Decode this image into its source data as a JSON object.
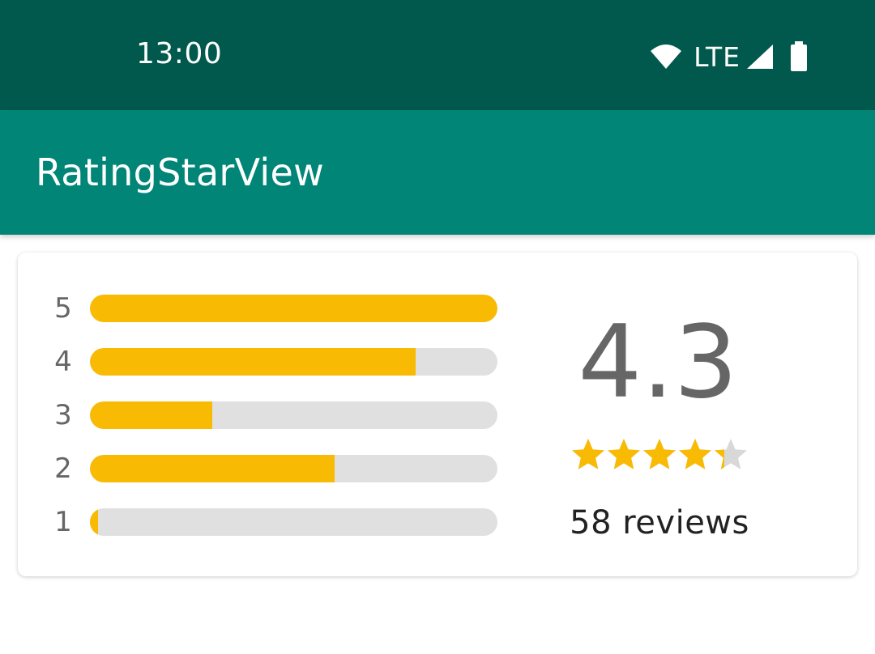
{
  "status_bar": {
    "time": "13:00",
    "network": "LTE",
    "icons": [
      "wifi-icon",
      "signal-icon",
      "battery-icon"
    ]
  },
  "app_bar": {
    "title": "RatingStarView"
  },
  "rating_card": {
    "rating_value": "4.3",
    "star_rating": 4.3,
    "max_stars": 5,
    "reviews_label": "58 reviews",
    "bars": [
      {
        "label": "5",
        "fill_fraction": 1.0
      },
      {
        "label": "4",
        "fill_fraction": 0.8
      },
      {
        "label": "3",
        "fill_fraction": 0.3
      },
      {
        "label": "2",
        "fill_fraction": 0.6
      },
      {
        "label": "1",
        "fill_fraction": 0.02
      }
    ]
  },
  "colors": {
    "status_bar": "#00594C",
    "app_bar": "#008577",
    "accent": "#F9BA03",
    "track": "#E0E0E0",
    "star_empty": "#D8D8D8"
  }
}
